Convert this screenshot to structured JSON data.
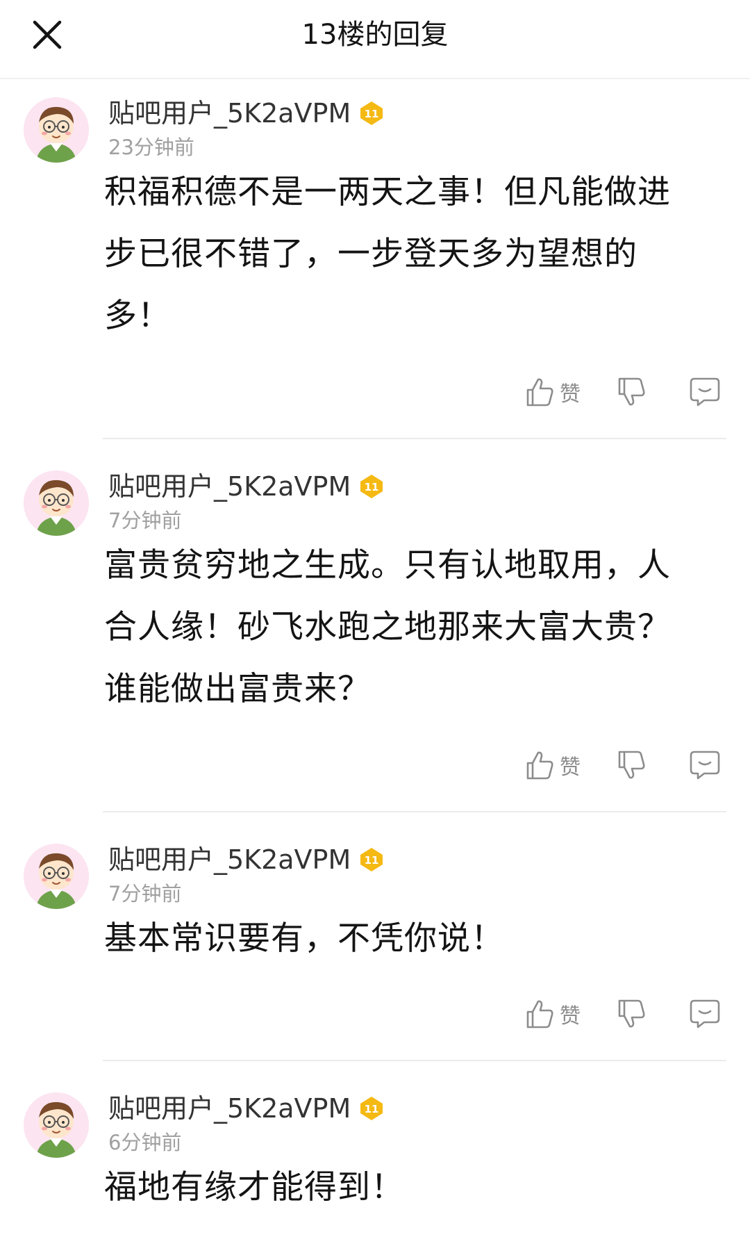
{
  "header": {
    "title": "13楼的回复"
  },
  "colors": {
    "background": "#ffffff",
    "text_primary": "#141414",
    "text_secondary": "#a0a0a0",
    "icon_gray": "#8c8c8c",
    "badge_gold": "#f5b914",
    "avatar_bg": "#fce4f1",
    "divider": "#ebebeb"
  },
  "comments": [
    {
      "username": "贴吧用户_5K2aVPM",
      "level": "11",
      "time": "23分钟前",
      "content_lines": [
        "积福积德不是一两天之事！但凡能做进",
        "步已很不错了，一步登天多为望想的",
        "多！"
      ],
      "like_label": "赞"
    },
    {
      "username": "贴吧用户_5K2aVPM",
      "level": "11",
      "time": "7分钟前",
      "content_lines": [
        "富贵贫穷地之生成。只有认地取用，人",
        "合人缘！砂飞水跑之地那来大富大贵？",
        "谁能做出富贵来？"
      ],
      "like_label": "赞"
    },
    {
      "username": "贴吧用户_5K2aVPM",
      "level": "11",
      "time": "7分钟前",
      "content_lines": [
        "基本常识要有，不凭你说！"
      ],
      "like_label": "赞"
    },
    {
      "username": "贴吧用户_5K2aVPM",
      "level": "11",
      "time": "6分钟前",
      "content_lines": [
        "福地有缘才能得到！"
      ],
      "like_label": "赞"
    }
  ]
}
